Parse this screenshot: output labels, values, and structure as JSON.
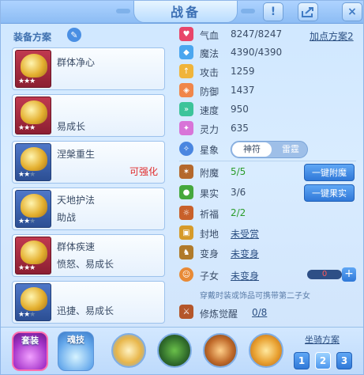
{
  "window": {
    "title": "战备"
  },
  "left_panel": {
    "section_label": "装备方案",
    "plans": [
      {
        "name": "群体净心",
        "subtitle": "",
        "enhance": "",
        "stars_filled": 3,
        "stars_total": 3,
        "theme": "red"
      },
      {
        "name": "",
        "subtitle": "易成长",
        "enhance": "",
        "stars_filled": 3,
        "stars_total": 3,
        "theme": "red"
      },
      {
        "name": "涅槃重生",
        "subtitle": "",
        "enhance": "可强化",
        "stars_filled": 2,
        "stars_total": 3,
        "theme": "blue"
      },
      {
        "name": "天地护法",
        "subtitle": "助战",
        "enhance": "",
        "stars_filled": 2,
        "stars_total": 3,
        "theme": "blue"
      },
      {
        "name": "群体疾速",
        "subtitle": "愤怒、易成长",
        "enhance": "",
        "stars_filled": 3,
        "stars_total": 3,
        "theme": "red"
      },
      {
        "name": "",
        "subtitle": "迅捷、易成长",
        "enhance": "",
        "stars_filled": 2,
        "stars_total": 3,
        "theme": "blue"
      }
    ]
  },
  "stats": {
    "hp_label": "气血",
    "hp_value": "8247/8247",
    "points_plan": "加点方案2",
    "mp_label": "魔法",
    "mp_value": "4390/4390",
    "atk_label": "攻击",
    "atk_value": "1259",
    "def_label": "防御",
    "def_value": "1437",
    "spd_label": "速度",
    "spd_value": "950",
    "spi_label": "灵力",
    "spi_value": "635"
  },
  "constellation": {
    "label": "星象",
    "option_on": "神符",
    "option_off": "雷霆"
  },
  "bonuses": {
    "enchant_label": "附魔",
    "enchant_value": "5/5",
    "enchant_button": "一键附魔",
    "fruit_label": "果实",
    "fruit_value": "3/6",
    "fruit_button": "一键果实",
    "bless_label": "祈福",
    "bless_value": "2/2",
    "seal_label": "封地",
    "seal_value": "未受赏",
    "transform_label": "变身",
    "transform_value": "未变身",
    "child_label": "子女",
    "child_value": "未变身",
    "child_count": "0",
    "child_note": "穿戴时装或饰品可携带第二子女",
    "train_label": "修炼觉醒",
    "train_value": "0/8"
  },
  "bottom": {
    "tab_equip": "套装",
    "tab_soul": "魂技",
    "mount_plan_label": "坐骑方案",
    "mount_plan_numbers": [
      "1",
      "2",
      "3"
    ]
  },
  "colors": {
    "accent": "#2f78d8",
    "enhance_red": "#e02c2c",
    "value_green": "#2a9c2a"
  }
}
